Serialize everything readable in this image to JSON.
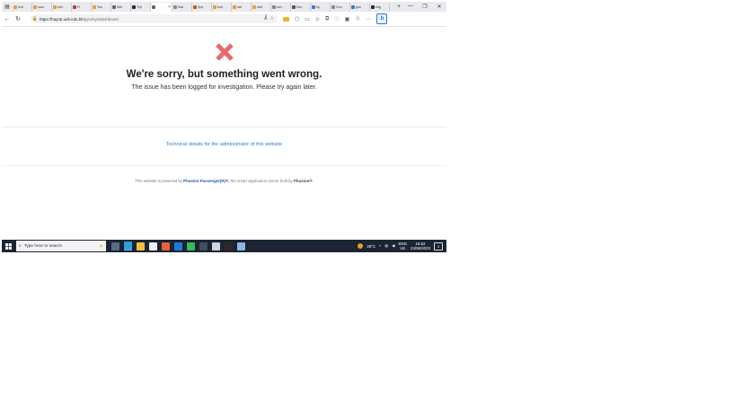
{
  "browser": {
    "tabs": [
      {
        "label": "mm",
        "color": "#e89c3b"
      },
      {
        "label": "nuru",
        "color": "#e89c3b"
      },
      {
        "label": "sim",
        "color": "#e89c3b"
      },
      {
        "label": "Pr",
        "color": "#c0392b"
      },
      {
        "label": "You",
        "color": "#e89c3b"
      },
      {
        "label": "Wel",
        "color": "#666666"
      },
      {
        "label": "Tryi",
        "color": "#24292e"
      },
      {
        "label": "",
        "color": "#666666",
        "active": true
      },
      {
        "label": "that",
        "color": "#888888"
      },
      {
        "label": "Spe",
        "color": "#d35400"
      },
      {
        "label": "mm",
        "color": "#e89c3b"
      },
      {
        "label": "dat",
        "color": "#e89c3b"
      },
      {
        "label": "mai",
        "color": "#e89c3b"
      },
      {
        "label": "sch",
        "color": "#888888"
      },
      {
        "label": "Dev",
        "color": "#555555"
      },
      {
        "label": "try",
        "color": "#3a76d8"
      },
      {
        "label": "Con",
        "color": "#888888"
      },
      {
        "label": "goo",
        "color": "#3a76d8"
      },
      {
        "label": "edg",
        "color": "#24292e"
      }
    ],
    "url_host": "https://hayrat.uob.edu.bh",
    "url_path": "/pyrs/sys/dashboard"
  },
  "page": {
    "title": "We're sorry, but something went wrong.",
    "subtitle": "The issue has been logged for investigation. Please try again later.",
    "tech_link": "Technical details for the administrator of this website",
    "powered_prefix": "This website is powered by ",
    "powered_name": "Phusion Passenger(R)®",
    "powered_mid": ", the smart application server built by ",
    "powered_org": "Phusion®",
    "powered_suffix": "."
  },
  "taskbar": {
    "search_placeholder": "Type here to search",
    "weather": "28°C",
    "lang_top": "ENG",
    "lang_bottom": "UK",
    "time": "18:52",
    "date": "24/06/2023",
    "notification_count": "3"
  },
  "colors": {
    "error_icon": "#e8696b",
    "link": "#2f7ec8",
    "taskbar_bg": "#1a2433"
  }
}
